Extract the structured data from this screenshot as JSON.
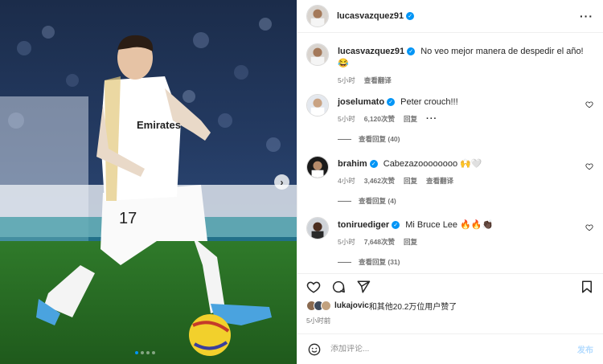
{
  "post": {
    "author": "lucasvazquez91",
    "photo_dots": 4,
    "photo_dot_active": 0
  },
  "caption": {
    "username": "lucasvazquez91",
    "text": "No veo mejor manera de despedir el año!",
    "emoji": "😂",
    "time": "5小时",
    "translate": "查看翻译"
  },
  "comments": [
    {
      "username": "joselumato",
      "text": "Peter crouch!!!",
      "time": "5小时",
      "likes": "6,120次赞",
      "reply": "回复",
      "more": "···",
      "replies": "查看回复 (40)"
    },
    {
      "username": "brahim",
      "text": "Cabezazoooooooo 🙌🤍",
      "time": "4小时",
      "likes": "3,462次赞",
      "reply": "回复",
      "translate": "查看翻译",
      "replies": "查看回复 (4)"
    },
    {
      "username": "toniruediger",
      "text": "Mi Bruce Lee 🔥🔥👏🏿",
      "time": "5小时",
      "likes": "7,648次赞",
      "reply": "回复",
      "replies": "查看回复 (31)"
    }
  ],
  "likes_line": {
    "user": "lukajovic",
    "rest": "和其他20.2万位用户赞了"
  },
  "posted_time": "5小时前",
  "comment_box": {
    "placeholder": "添加评论...",
    "post_label": "发布"
  },
  "colors": {
    "verified": "#0095f6",
    "muted": "#737373",
    "post_disabled": "#b3dbff"
  },
  "icons": [
    "more-icon",
    "heart-icon",
    "comment-icon",
    "share-icon",
    "bookmark-icon",
    "emoji-icon",
    "chevron-right-icon",
    "verified-badge-icon"
  ]
}
